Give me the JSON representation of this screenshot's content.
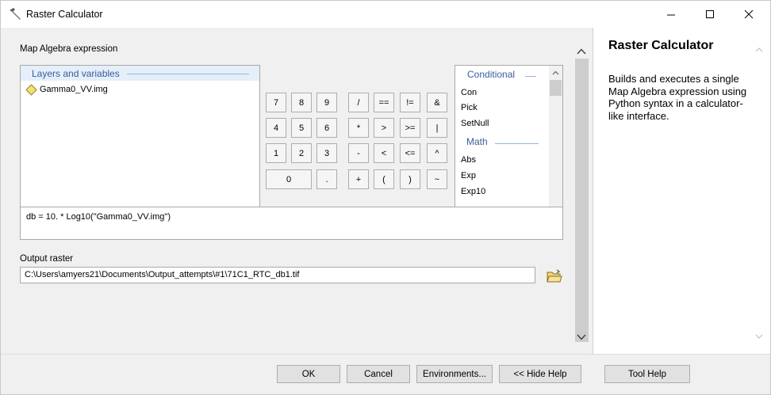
{
  "window": {
    "title": "Raster Calculator",
    "title_icon": "hammer-icon",
    "controls": [
      "minimize-icon",
      "maximize-icon",
      "close-icon"
    ]
  },
  "main": {
    "expression_label": "Map Algebra expression",
    "layers_header": "Layers and variables",
    "layers": [
      {
        "name": "Gamma0_VV.img",
        "icon": "raster-layer-diamond-icon"
      }
    ],
    "calculator": {
      "rows": [
        [
          "7",
          "8",
          "9",
          "/",
          "==",
          "!=",
          "&"
        ],
        [
          "4",
          "5",
          "6",
          "*",
          ">",
          ">=",
          "|"
        ],
        [
          "1",
          "2",
          "3",
          "-",
          "<",
          "<=",
          "^"
        ],
        [
          "0",
          ".",
          "+",
          "(",
          ")",
          "~"
        ]
      ]
    },
    "functions": {
      "sections": [
        {
          "title": "Conditional",
          "items": [
            "Con",
            "Pick",
            "SetNull"
          ]
        },
        {
          "title": "Math",
          "items": [
            "Abs",
            "Exp",
            "Exp10"
          ]
        }
      ]
    },
    "expression": "db = 10. * Log10(\"Gamma0_VV.img\")",
    "output_label": "Output raster",
    "output_value": "C:\\Users\\amyers21\\Documents\\Output_attempts\\#1\\71C1_RTC_db1.tif",
    "browse_icon": "open-folder-icon"
  },
  "help": {
    "title": "Raster Calculator",
    "body": "Builds and executes a single Map Algebra expression using Python syntax in a calculator-like interface."
  },
  "footer": {
    "ok": "OK",
    "cancel": "Cancel",
    "environments": "Environments...",
    "hide_help": "<< Hide Help",
    "tool_help": "Tool Help"
  },
  "colors": {
    "header_text": "#3a5d9c",
    "header_bg": "#e5effa",
    "dialog_bg": "#f0f0f0"
  }
}
